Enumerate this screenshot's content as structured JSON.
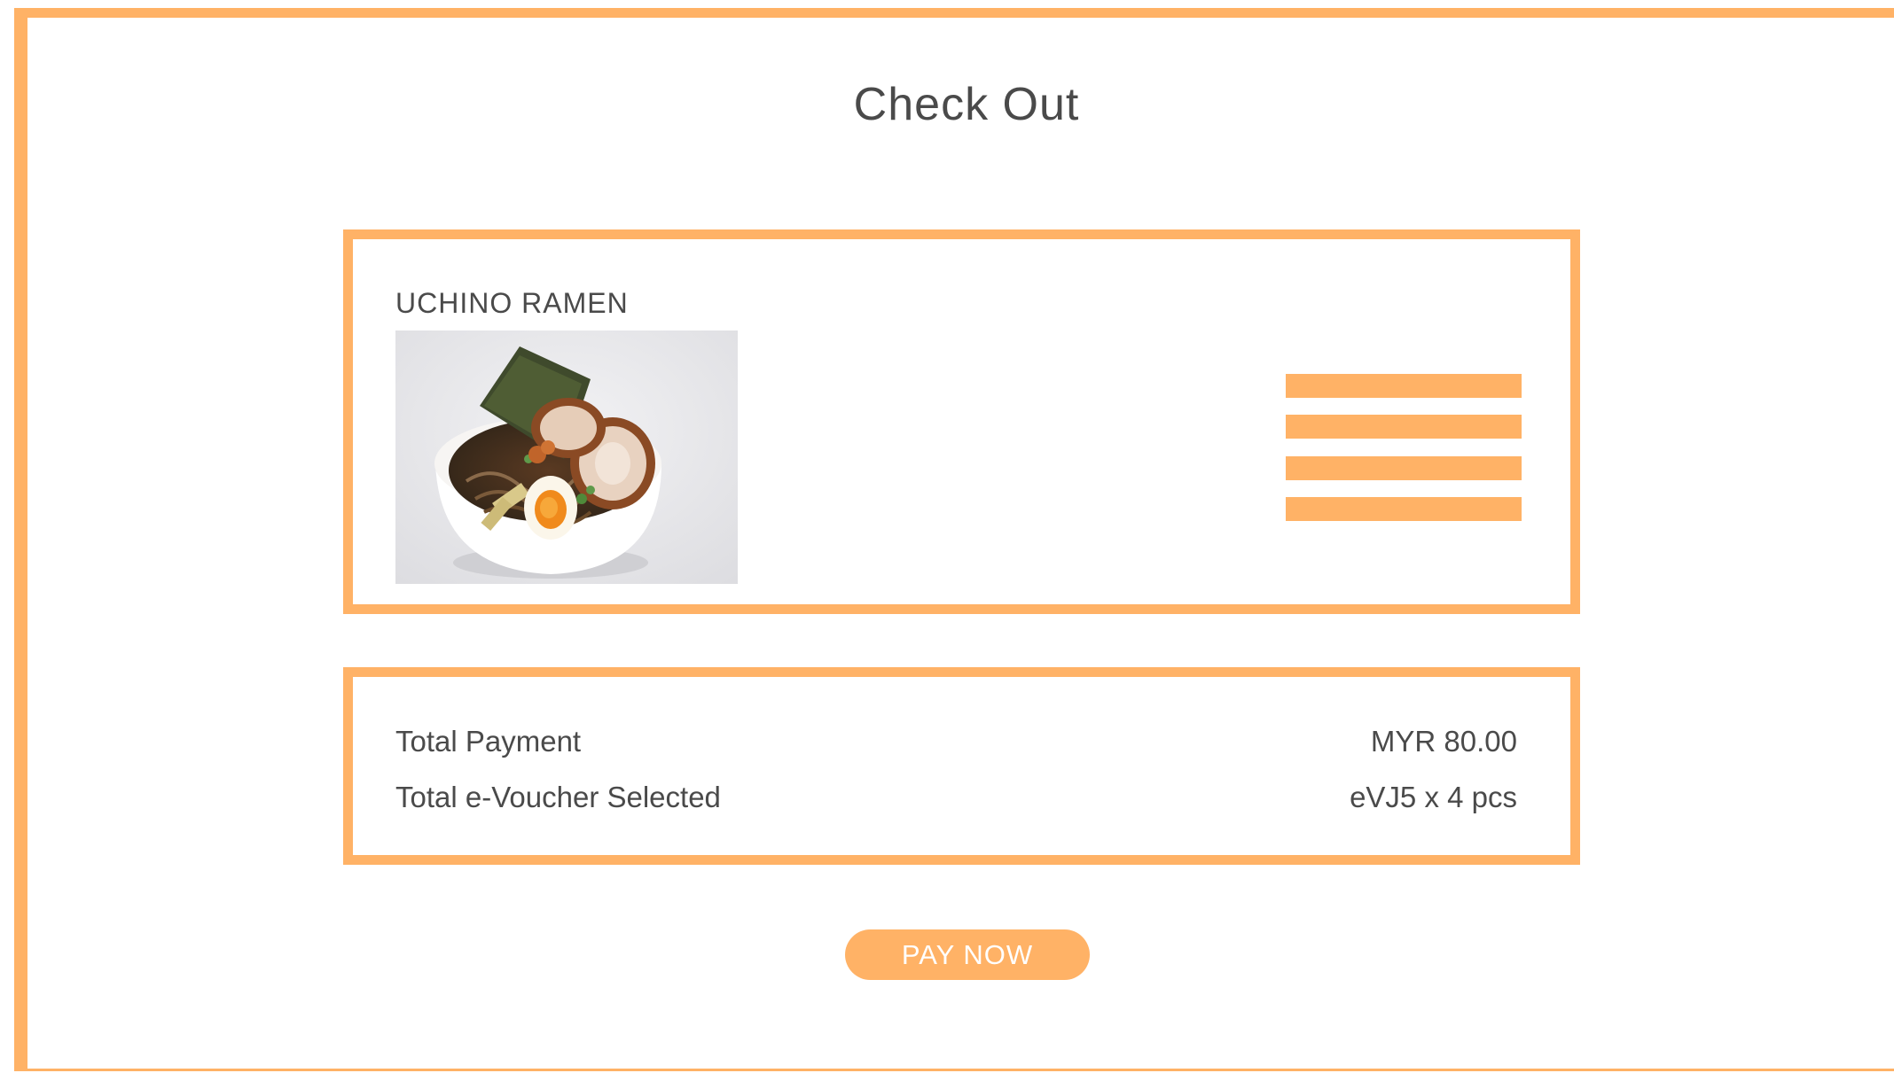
{
  "page": {
    "title": "Check Out"
  },
  "order": {
    "restaurant_name": "UCHINO RAMEN",
    "image_icon": "ramen-bowl-photo"
  },
  "summary": {
    "total_payment_label": "Total Payment",
    "total_payment_value": "MYR 80.00",
    "voucher_label": "Total e-Voucher Selected",
    "voucher_value": "eVJ5 x 4 pcs"
  },
  "actions": {
    "pay_label": "PAY NOW"
  },
  "colors": {
    "accent": "#ffb266",
    "text": "#4a4a4a",
    "background": "#ffffff"
  }
}
